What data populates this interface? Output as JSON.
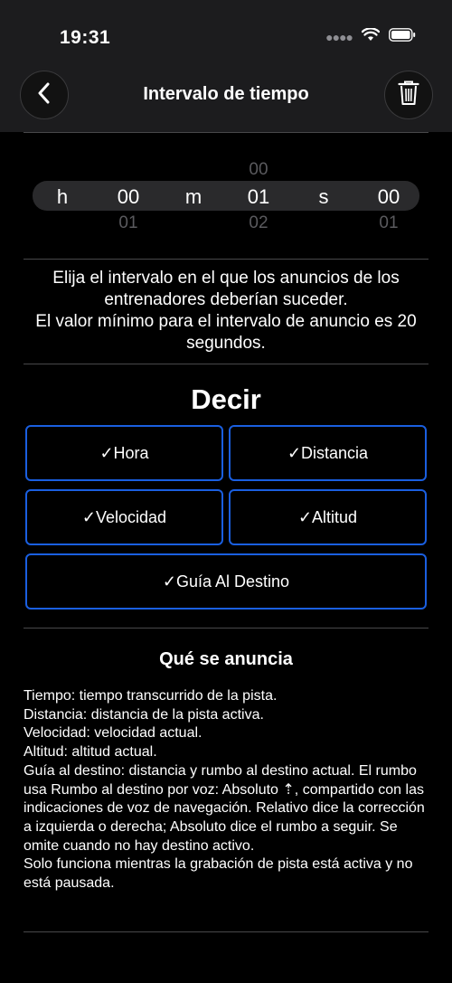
{
  "status_bar": {
    "time": "19:31"
  },
  "nav": {
    "title": "Intervalo de tiempo"
  },
  "picker": {
    "hours_label": "h",
    "hours_value": "00",
    "hours_next": "01",
    "minutes_label": "m",
    "minutes_prev": "00",
    "minutes_value": "01",
    "minutes_next": "02",
    "seconds_label": "s",
    "seconds_value": "00",
    "seconds_next": "01"
  },
  "description": "Elija el intervalo en el que los anuncios de los entrenadores deberían suceder.\nEl valor mínimo para el intervalo de anuncio es 20 segundos.",
  "say_section": {
    "title": "Decir",
    "options": [
      "✓Hora",
      "✓Distancia",
      "✓Velocidad",
      "✓Altitud",
      "✓Guía Al Destino"
    ]
  },
  "info_section": {
    "title": "Qué se anuncia",
    "lines": [
      "Tiempo: tiempo transcurrido de la pista.",
      "Distancia: distancia de la pista activa.",
      "Velocidad: velocidad actual.",
      "Altitud: altitud actual.",
      "Guía al destino: distancia y rumbo al destino actual. El rumbo usa Rumbo al destino por voz: Absoluto ⇡, compartido con las indicaciones de voz de navegación. Relativo dice la corrección a izquierda o derecha; Absoluto dice el rumbo a seguir. Se omite cuando no hay destino activo.",
      "Solo funciona mientras la grabación de pista está activa y no está pausada."
    ]
  },
  "icons": {
    "back": "chevron-left-icon",
    "trash": "trash-icon",
    "signal": "cellular-icon",
    "wifi": "wifi-icon",
    "battery": "battery-icon"
  },
  "colors": {
    "accent": "#1a5fe0",
    "background": "#000000",
    "bar": "#1c1c1e"
  }
}
